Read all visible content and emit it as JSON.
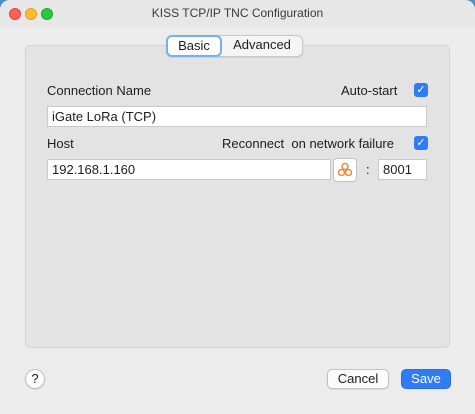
{
  "window": {
    "title": "KISS TCP/IP TNC Configuration"
  },
  "tabs": [
    {
      "label": "Basic",
      "selected": true
    },
    {
      "label": "Advanced",
      "selected": false
    }
  ],
  "connection": {
    "name_label": "Connection Name",
    "name_value": "iGate LoRa (TCP)",
    "autostart_label": "Auto-start",
    "autostart_checked": true
  },
  "host": {
    "label": "Host",
    "value": "192.168.1.160",
    "reconnect_label": "Reconnect  on network failure",
    "reconnect_checked": true,
    "colon": ":",
    "port_value": "8001"
  },
  "footer": {
    "help_label": "?",
    "cancel_label": "Cancel",
    "save_label": "Save"
  },
  "colors": {
    "accent": "#2f7cf6",
    "close": "#fe5f57",
    "minimize": "#febc2e",
    "maximize": "#28c840"
  },
  "icons": {
    "network_browse": "bonjour-network-icon",
    "checkbox": "checkmark-icon"
  }
}
